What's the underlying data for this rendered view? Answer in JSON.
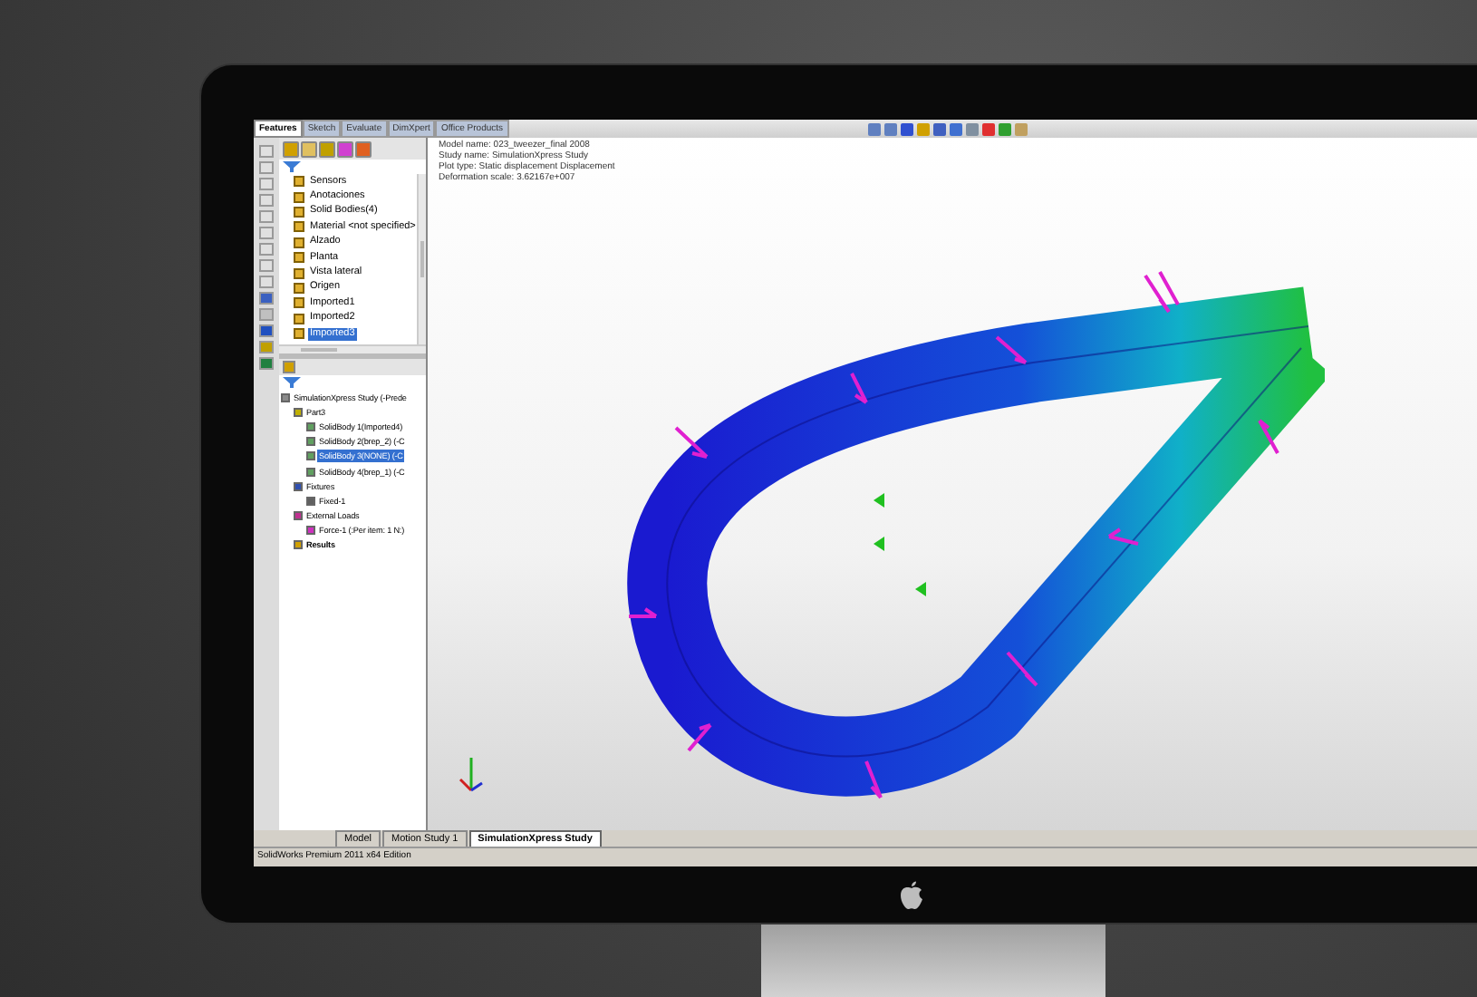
{
  "feature_tabs": [
    {
      "label": "Features",
      "selected": true
    },
    {
      "label": "Sketch",
      "selected": false
    },
    {
      "label": "Evaluate",
      "selected": false
    },
    {
      "label": "DimXpert",
      "selected": false
    },
    {
      "label": "Office Products",
      "selected": false
    }
  ],
  "feature_tree": [
    {
      "label": "Sensors",
      "selected": false
    },
    {
      "label": "Anotaciones",
      "selected": false
    },
    {
      "label": "Solid Bodies(4)",
      "selected": false
    },
    {
      "label": "Material <not specified>",
      "selected": false
    },
    {
      "label": "Alzado",
      "selected": false
    },
    {
      "label": "Planta",
      "selected": false
    },
    {
      "label": "Vista lateral",
      "selected": false
    },
    {
      "label": "Origen",
      "selected": false
    },
    {
      "label": "Imported1",
      "selected": false
    },
    {
      "label": "Imported2",
      "selected": false
    },
    {
      "label": "Imported3",
      "selected": true
    }
  ],
  "study_tree": [
    {
      "label": "SimulationXpress Study (-Prede",
      "selected": false,
      "kind": "study",
      "children": [
        {
          "label": "Part3",
          "selected": false,
          "kind": "part",
          "children": [
            {
              "label": "SolidBody 1(Imported4)",
              "selected": false,
              "kind": "body"
            },
            {
              "label": "SolidBody 2(brep_2) (-C",
              "selected": false,
              "kind": "body"
            },
            {
              "label": "SolidBody 3(NONE) (-C",
              "selected": true,
              "kind": "body"
            },
            {
              "label": "SolidBody 4(brep_1) (-C",
              "selected": false,
              "kind": "body"
            }
          ]
        },
        {
          "label": "Fixtures",
          "selected": false,
          "kind": "fixtures",
          "children": [
            {
              "label": "Fixed-1",
              "selected": false,
              "kind": "fixed"
            }
          ]
        },
        {
          "label": "External Loads",
          "selected": false,
          "kind": "loads",
          "children": [
            {
              "label": "Force-1 (:Per item: 1 N:)",
              "selected": false,
              "kind": "force"
            }
          ]
        },
        {
          "label": "Results",
          "selected": false,
          "kind": "results"
        }
      ]
    }
  ],
  "model_info": [
    "Model name: 023_tweezer_final 2008",
    "Study name: SimulationXpress Study",
    "Plot type: Static displacement Displacement",
    "Deformation scale: 3.62167e+007"
  ],
  "bottom_tabs": [
    {
      "label": "Model",
      "selected": false
    },
    {
      "label": "Motion Study 1",
      "selected": false
    },
    {
      "label": "SimulationXpress Study",
      "selected": true
    }
  ],
  "status_bar": "SolidWorks Premium 2011 x64 Edition"
}
